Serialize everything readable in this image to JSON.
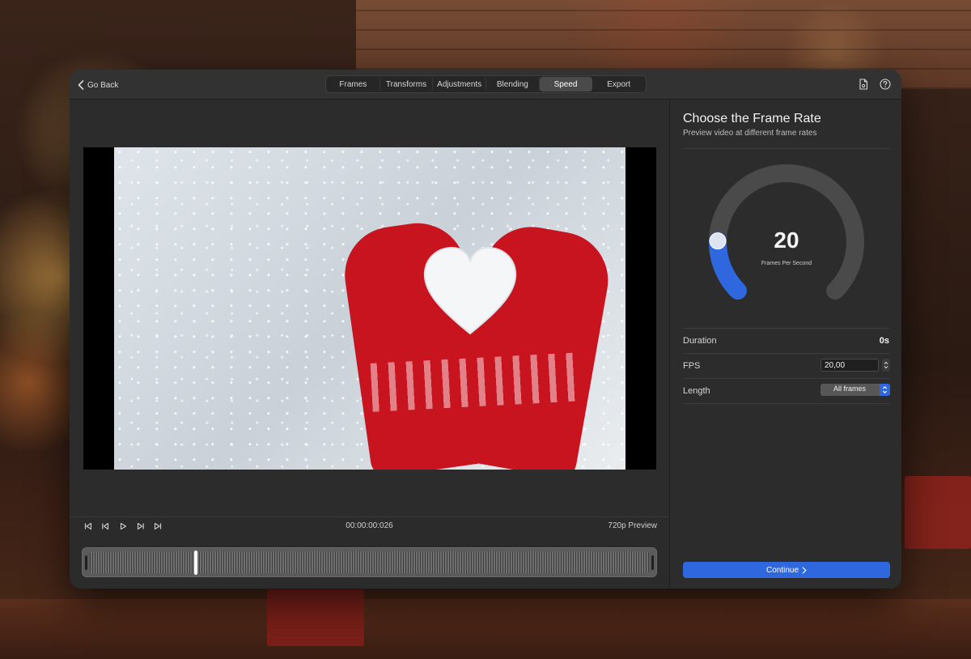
{
  "nav": {
    "back_label": "Go Back",
    "tabs": [
      {
        "label": "Frames",
        "active": false
      },
      {
        "label": "Transforms",
        "active": false
      },
      {
        "label": "Adjustments",
        "active": false
      },
      {
        "label": "Blending",
        "active": false
      },
      {
        "label": "Speed",
        "active": true
      },
      {
        "label": "Export",
        "active": false
      }
    ],
    "icons": [
      "document-icon",
      "help-icon"
    ]
  },
  "player": {
    "timecode": "00:00:00:026",
    "quality": "720p Preview",
    "playhead_fraction": 0.19
  },
  "panel": {
    "title": "Choose the Frame Rate",
    "subtitle": "Preview video at different frame rates",
    "dial": {
      "value": "20",
      "caption": "Frames Per Second",
      "fraction": 0.17,
      "accent": "#2f67de"
    },
    "duration": {
      "label": "Duration",
      "value": "0s"
    },
    "fps": {
      "label": "FPS",
      "value": "20,00"
    },
    "length": {
      "label": "Length",
      "value": "All frames"
    },
    "continue_label": "Continue"
  },
  "colors": {
    "accent": "#2f67de",
    "window_bg": "#2b2b2b",
    "titlebar_bg": "#323232"
  }
}
